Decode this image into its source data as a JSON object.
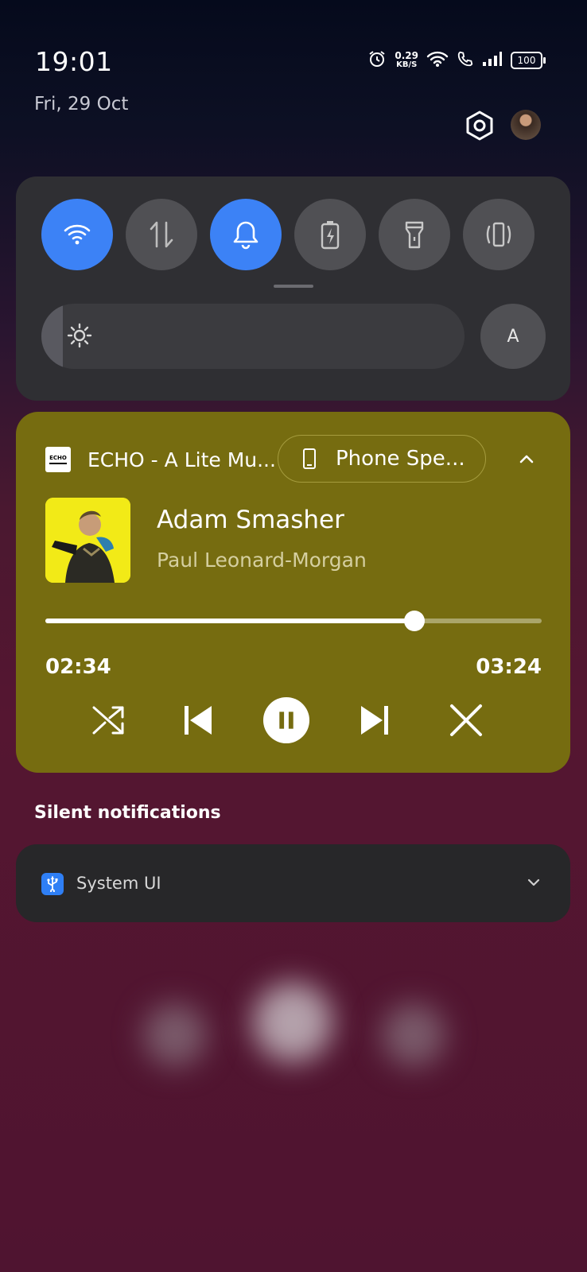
{
  "status_bar": {
    "time": "19:01",
    "date": "Fri, 29 Oct",
    "net_speed_value": "0.29",
    "net_speed_unit": "KB/S",
    "battery": "100"
  },
  "quick_settings": {
    "tiles": [
      {
        "name": "wifi",
        "icon": "wifi-icon",
        "active": true
      },
      {
        "name": "mobile-data",
        "icon": "data-arrows-icon",
        "active": false
      },
      {
        "name": "sound",
        "icon": "bell-icon",
        "active": true
      },
      {
        "name": "battery-saver",
        "icon": "battery-bolt-icon",
        "active": false
      },
      {
        "name": "flashlight",
        "icon": "flashlight-icon",
        "active": false
      },
      {
        "name": "vibrate",
        "icon": "vibrate-icon",
        "active": false
      }
    ],
    "brightness_level": 0.05,
    "auto_brightness_label": "A"
  },
  "media": {
    "app_icon_text": "ECHO",
    "app_name": "ECHO - A Lite Mu...",
    "output_device": "Phone Spe...",
    "song_title": "Adam Smasher",
    "artist": "Paul Leonard-Morgan",
    "elapsed": "02:34",
    "duration": "03:24",
    "progress": 0.743,
    "card_color": "#766c10"
  },
  "notifications": {
    "section_label": "Silent notifications",
    "items": [
      {
        "app": "System UI",
        "icon": "usb-icon"
      }
    ]
  }
}
